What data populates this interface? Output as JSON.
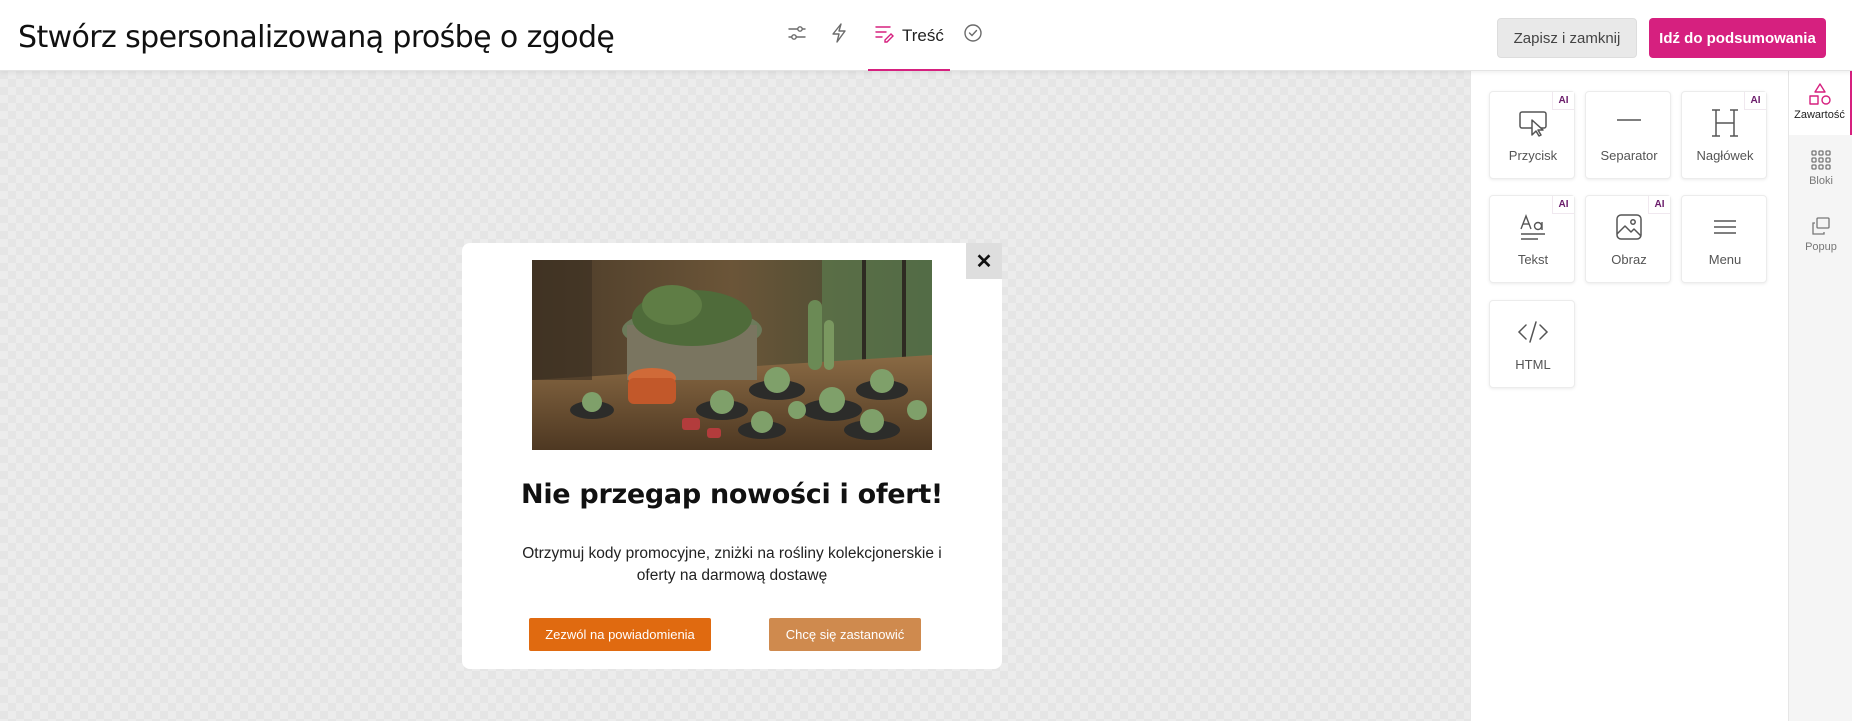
{
  "header": {
    "title": "Stwórz spersonalizowaną prośbę o zgodę",
    "steps": [
      {
        "icon": "sliders-icon",
        "label": ""
      },
      {
        "icon": "lightning-icon",
        "label": ""
      },
      {
        "icon": "content-edit-icon",
        "label": "Treść"
      },
      {
        "icon": "check-circle-icon",
        "label": ""
      }
    ],
    "save_label": "Zapisz i zamknij",
    "summary_label": "Idź do podsumowania"
  },
  "popup": {
    "close_glyph": "✕",
    "image_alt": "plants-photo",
    "heading": "Nie przegap nowości i ofert!",
    "text_line1": "Otrzymuj kody promocyjne, zniżki na rośliny kolekcjonerskie i",
    "text_line2": "oferty na darmową dostawę",
    "allow_label": "Zezwól na powiadomienia",
    "later_label": "Chcę się zastanowić"
  },
  "panel": {
    "tiles": [
      {
        "label": "Przycisk",
        "icon": "button-cursor-icon",
        "ai": "AI"
      },
      {
        "label": "Separator",
        "icon": "separator-icon"
      },
      {
        "label": "Nagłówek",
        "icon": "heading-icon",
        "ai": "AI"
      },
      {
        "label": "Tekst",
        "icon": "text-icon",
        "ai": "AI"
      },
      {
        "label": "Obraz",
        "icon": "image-icon",
        "ai": "AI"
      },
      {
        "label": "Menu",
        "icon": "menu-icon"
      },
      {
        "label": "HTML",
        "icon": "code-icon"
      }
    ]
  },
  "side_tabs": [
    {
      "label": "Zawartość",
      "icon": "shapes-icon",
      "active": true
    },
    {
      "label": "Bloki",
      "icon": "grid-icon"
    },
    {
      "label": "Popup",
      "icon": "popup-icon"
    }
  ],
  "colors": {
    "accent": "#d6207f",
    "allow_button": "#e06a10",
    "later_button": "#cf8a4e",
    "ai_badge": "#6a1b6a"
  }
}
